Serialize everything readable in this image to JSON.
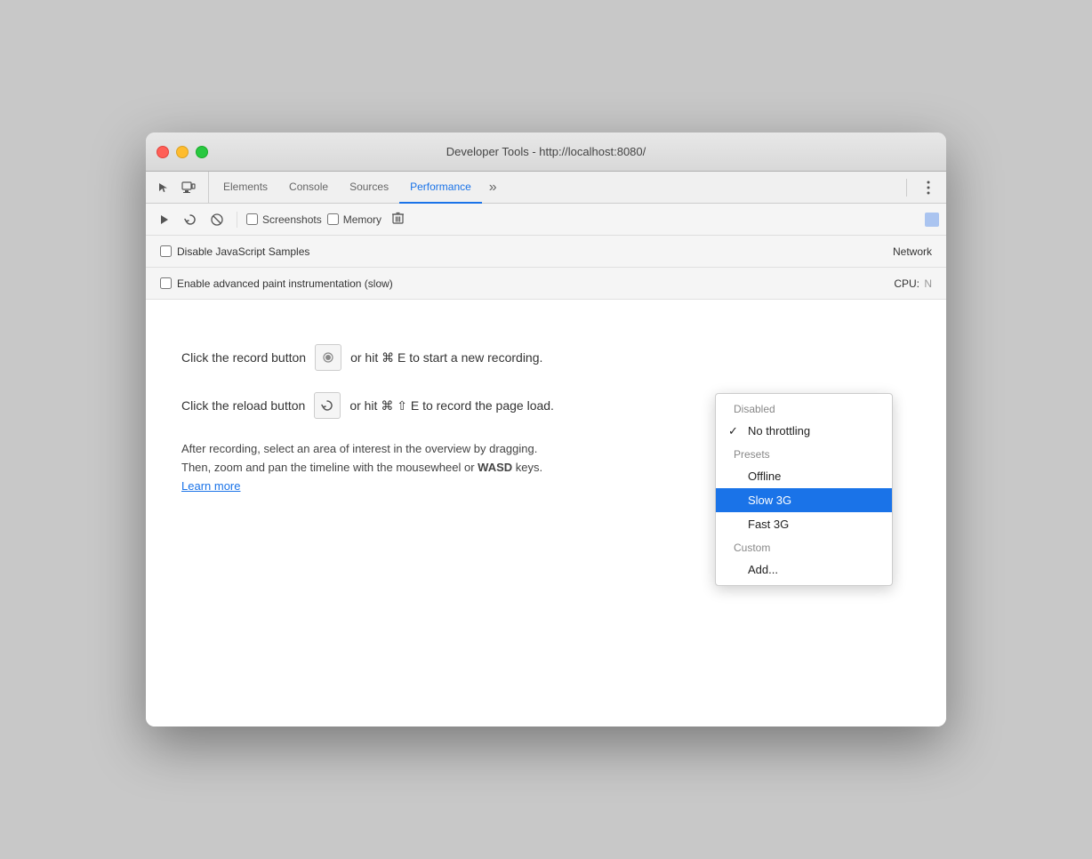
{
  "window": {
    "title": "Developer Tools - http://localhost:8080/"
  },
  "tabs": [
    {
      "id": "elements",
      "label": "Elements",
      "active": false
    },
    {
      "id": "console",
      "label": "Console",
      "active": false
    },
    {
      "id": "sources",
      "label": "Sources",
      "active": false
    },
    {
      "id": "performance",
      "label": "Performance",
      "active": true
    }
  ],
  "toolbar": {
    "screenshots_label": "Screenshots",
    "memory_label": "Memory"
  },
  "options": {
    "disable_js_label": "Disable JavaScript Samples",
    "paint_label": "Enable advanced paint instrumentation (slow)",
    "network_label": "Network",
    "cpu_label": "CPU:"
  },
  "content": {
    "record_text": "Click the record button",
    "record_or": "or hit ⌘ E to start a new recording.",
    "reload_text": "Click the reload button",
    "reload_or": "or hit ⌘ ⇧ E to record the page load.",
    "note_line1": "After recording, select an area of interest in the overview by dragging.",
    "note_line2": "Then, zoom and pan the timeline with the mousewheel or",
    "note_bold": "WASD",
    "note_line2_end": "keys.",
    "learn_more": "Learn more"
  },
  "dropdown": {
    "items": [
      {
        "id": "disabled",
        "label": "Disabled",
        "type": "category"
      },
      {
        "id": "no-throttling",
        "label": "No throttling",
        "checked": true,
        "type": "item"
      },
      {
        "id": "presets",
        "label": "Presets",
        "type": "category"
      },
      {
        "id": "offline",
        "label": "Offline",
        "type": "item"
      },
      {
        "id": "slow-3g",
        "label": "Slow 3G",
        "type": "item",
        "selected": true
      },
      {
        "id": "fast-3g",
        "label": "Fast 3G",
        "type": "item"
      },
      {
        "id": "custom",
        "label": "Custom",
        "type": "category"
      },
      {
        "id": "add",
        "label": "Add...",
        "type": "item"
      }
    ]
  }
}
